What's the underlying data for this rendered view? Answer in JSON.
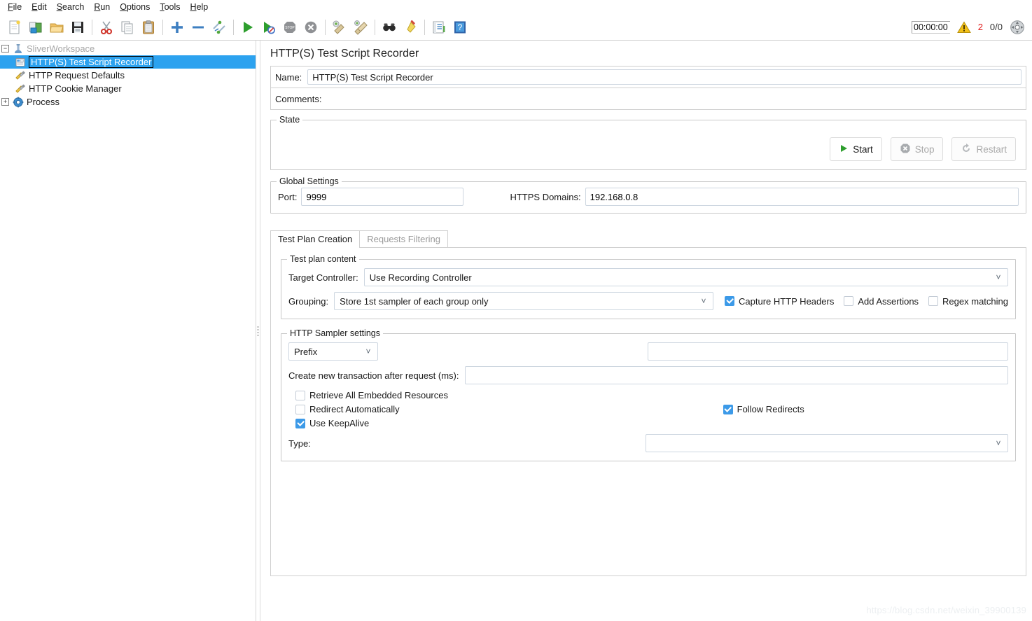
{
  "menubar": {
    "items": [
      {
        "label": "File",
        "mnemonic": "F"
      },
      {
        "label": "Edit",
        "mnemonic": "E"
      },
      {
        "label": "Search",
        "mnemonic": "S"
      },
      {
        "label": "Run",
        "mnemonic": "R"
      },
      {
        "label": "Options",
        "mnemonic": "O"
      },
      {
        "label": "Tools",
        "mnemonic": "T"
      },
      {
        "label": "Help",
        "mnemonic": "H"
      }
    ]
  },
  "toolbar": {
    "icons": [
      "new-icon",
      "templates-icon",
      "open-icon",
      "save-icon",
      "cut-icon",
      "copy-icon",
      "paste-icon",
      "expand-icon",
      "collapse-icon",
      "toggle-icon",
      "start-icon",
      "start-no-timers-icon",
      "stop-icon",
      "shutdown-icon",
      "clear-icon",
      "clear-all-icon",
      "search-icon",
      "search-reset-icon",
      "function-helper-icon",
      "help-icon"
    ],
    "timer": "00:00:00",
    "warning_icon": "warning-triangle-icon",
    "warning_count": "2",
    "thread_count": "0/0",
    "status_icon": "connection-status-icon"
  },
  "tree": {
    "nodes": [
      {
        "label": "SliverWorkspace",
        "icon": "test-plan-icon",
        "depth": 0,
        "toggle": "-",
        "selected": false,
        "disabled": true
      },
      {
        "label": "HTTP(S) Test Script Recorder",
        "icon": "recorder-icon",
        "depth": 1,
        "toggle": "",
        "selected": true,
        "disabled": false
      },
      {
        "label": "HTTP Request Defaults",
        "icon": "config-element-icon",
        "depth": 1,
        "toggle": "",
        "selected": false,
        "disabled": false
      },
      {
        "label": "HTTP Cookie Manager",
        "icon": "config-element-icon",
        "depth": 1,
        "toggle": "",
        "selected": false,
        "disabled": false
      },
      {
        "label": "Process",
        "icon": "thread-group-icon",
        "depth": 0,
        "toggle": "+",
        "selected": false,
        "disabled": false
      }
    ]
  },
  "content": {
    "title": "HTTP(S) Test Script Recorder",
    "name_label": "Name:",
    "name_value": "HTTP(S) Test Script Recorder",
    "comments_label": "Comments:",
    "comments_value": "",
    "state": {
      "group_title": "State",
      "start_label": "Start",
      "start_icon": "play-icon",
      "stop_label": "Stop",
      "stop_icon": "stop-icon",
      "restart_label": "Restart",
      "restart_icon": "restart-icon"
    },
    "global_settings": {
      "group_title": "Global Settings",
      "port_label": "Port:",
      "port_value": "9999",
      "domains_label": "HTTPS Domains:",
      "domains_value": "192.168.0.8"
    },
    "tabs": [
      {
        "label": "Test Plan Creation",
        "active": true
      },
      {
        "label": "Requests Filtering",
        "active": false
      }
    ],
    "test_plan_content": {
      "group_title": "Test plan content",
      "target_controller_label": "Target Controller:",
      "target_controller_value": "Use Recording Controller",
      "grouping_label": "Grouping:",
      "grouping_value": "Store 1st sampler of each group only",
      "capture_headers_label": "Capture HTTP Headers",
      "capture_headers_checked": true,
      "add_assertions_label": "Add Assertions",
      "add_assertions_checked": false,
      "regex_matching_label": "Regex matching",
      "regex_matching_checked": false
    },
    "sampler_settings": {
      "group_title": "HTTP Sampler settings",
      "naming_mode_value": "Prefix",
      "prefix_value": "",
      "transaction_label": "Create new transaction after request (ms):",
      "transaction_value": "",
      "retrieve_embedded_label": "Retrieve All Embedded Resources",
      "retrieve_embedded_checked": false,
      "redirect_auto_label": "Redirect Automatically",
      "redirect_auto_checked": false,
      "follow_redirects_label": "Follow Redirects",
      "follow_redirects_checked": true,
      "keepalive_label": "Use KeepAlive",
      "keepalive_checked": true,
      "type_label": "Type:",
      "type_value": ""
    }
  },
  "watermark": "https://blog.csdn.net/weixin_39900139",
  "colors": {
    "selection": "#2ca2ef",
    "checkbox_checked": "#3c9ae8",
    "warning_red": "#e01b1b",
    "start_green": "#2e9e2e"
  }
}
